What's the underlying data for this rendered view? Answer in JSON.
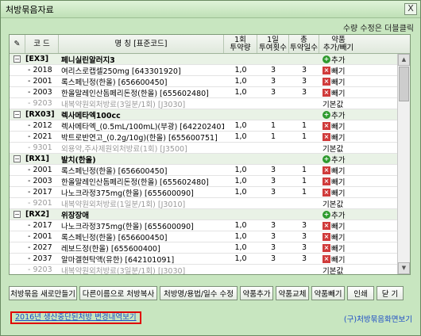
{
  "window": {
    "title": "처방묶음자료",
    "close_label": "X"
  },
  "hint": "수량 수정은 더블클릭",
  "header": {
    "c1": "코 드",
    "c2": "명 칭 [표준코드]",
    "c3": "1회\n투약량",
    "c4": "1일\n투여횟수",
    "c5": "총\n투약일수",
    "c6": "약품\n추가/빼기"
  },
  "rows": [
    {
      "type": "group",
      "code": "[EX3]",
      "name": "페니실린알러지3",
      "action": "추가"
    },
    {
      "type": "item",
      "code": "- 2018",
      "name": "여리스로캡셀250mg [643301920]",
      "q1": "1,0",
      "q2": "3",
      "q3": "3",
      "action": "빼기"
    },
    {
      "type": "item",
      "code": "- 2001",
      "name": "록스페닌정(한올) [656600450]",
      "q1": "1,0",
      "q2": "3",
      "q3": "3",
      "action": "빼기"
    },
    {
      "type": "item",
      "code": "- 2003",
      "name": "한올말레인산돔페리돈정(한올) [655602480]",
      "q1": "1,0",
      "q2": "3",
      "q3": "3",
      "action": "빼기"
    },
    {
      "type": "sub",
      "code": "- 9203",
      "name": "내복약원외처방료(3일분/1회) [J3030]",
      "q1": "",
      "q2": "",
      "q3": "",
      "action": "기본값"
    },
    {
      "type": "group",
      "code": "[RX03]",
      "name": "렉사메타엑100cc",
      "action": "추가"
    },
    {
      "type": "item",
      "code": "- 2012",
      "name": "렉사메타엑_(0.5mL/100mL)(부광) [642202401]",
      "q1": "1,0",
      "q2": "1",
      "q3": "1",
      "action": "빼기"
    },
    {
      "type": "item",
      "code": "- 2021",
      "name": "박트로반연고_(0.2g/10g)(한올) [655600751]",
      "q1": "1,0",
      "q2": "1",
      "q3": "1",
      "action": "빼기"
    },
    {
      "type": "sub",
      "code": "- 9301",
      "name": "외용약,주사제원외처방료(1회) [J3500]",
      "q1": "",
      "q2": "",
      "q3": "",
      "action": "기본값"
    },
    {
      "type": "group",
      "code": "[RX1]",
      "name": "발치(한올)",
      "action": "추가"
    },
    {
      "type": "item",
      "code": "- 2001",
      "name": "록스페닌정(한올) [656600450]",
      "q1": "1,0",
      "q2": "3",
      "q3": "1",
      "action": "빼기"
    },
    {
      "type": "item",
      "code": "- 2003",
      "name": "한올말레인산돔페리돈정(한올) [655602480]",
      "q1": "1,0",
      "q2": "3",
      "q3": "1",
      "action": "빼기"
    },
    {
      "type": "item",
      "code": "- 2017",
      "name": "나노크라정375mg(한올) [655600090]",
      "q1": "1,0",
      "q2": "3",
      "q3": "1",
      "action": "빼기"
    },
    {
      "type": "sub",
      "code": "- 9201",
      "name": "내복약원외처방료(1일분/1회) [J3010]",
      "q1": "",
      "q2": "",
      "q3": "",
      "action": "기본값"
    },
    {
      "type": "group",
      "code": "[RX2]",
      "name": "위장장애",
      "action": "추가"
    },
    {
      "type": "item",
      "code": "- 2017",
      "name": "나노크라정375mg(한올) [655600090]",
      "q1": "1,0",
      "q2": "3",
      "q3": "3",
      "action": "빼기"
    },
    {
      "type": "item",
      "code": "- 2001",
      "name": "록스페닌정(한올) [656600450]",
      "q1": "1,0",
      "q2": "3",
      "q3": "3",
      "action": "빼기"
    },
    {
      "type": "item",
      "code": "- 2027",
      "name": "레보드정(한올) [655600400]",
      "q1": "1,0",
      "q2": "3",
      "q3": "3",
      "action": "빼기"
    },
    {
      "type": "item",
      "code": "- 2037",
      "name": "알마겔현탁액(유한) [642101091]",
      "q1": "1,0",
      "q2": "3",
      "q3": "3",
      "action": "빼기"
    },
    {
      "type": "sub",
      "code": "- 9203",
      "name": "내복약원외처방료(3일분/1회) [J3030]",
      "q1": "",
      "q2": "",
      "q3": "",
      "action": "기본값"
    },
    {
      "type": "group",
      "code": "[RX3]",
      "name": "발치(지치)",
      "action": "추가"
    }
  ],
  "buttons": {
    "new_bundle": "처방묶음 새로만들기",
    "copy_other": "다른이름으로 처방복사",
    "edit_name": "처방명/용법/일수 수정",
    "add_drug": "약품추가",
    "swap_drug": "약품교체",
    "remove_drug": "약품빼기",
    "print": "인쇄",
    "close": "닫 기"
  },
  "footer": {
    "link": "2016년 생산중단된처방 변경내역보기",
    "right": "(구)처방묶음화면보기"
  }
}
